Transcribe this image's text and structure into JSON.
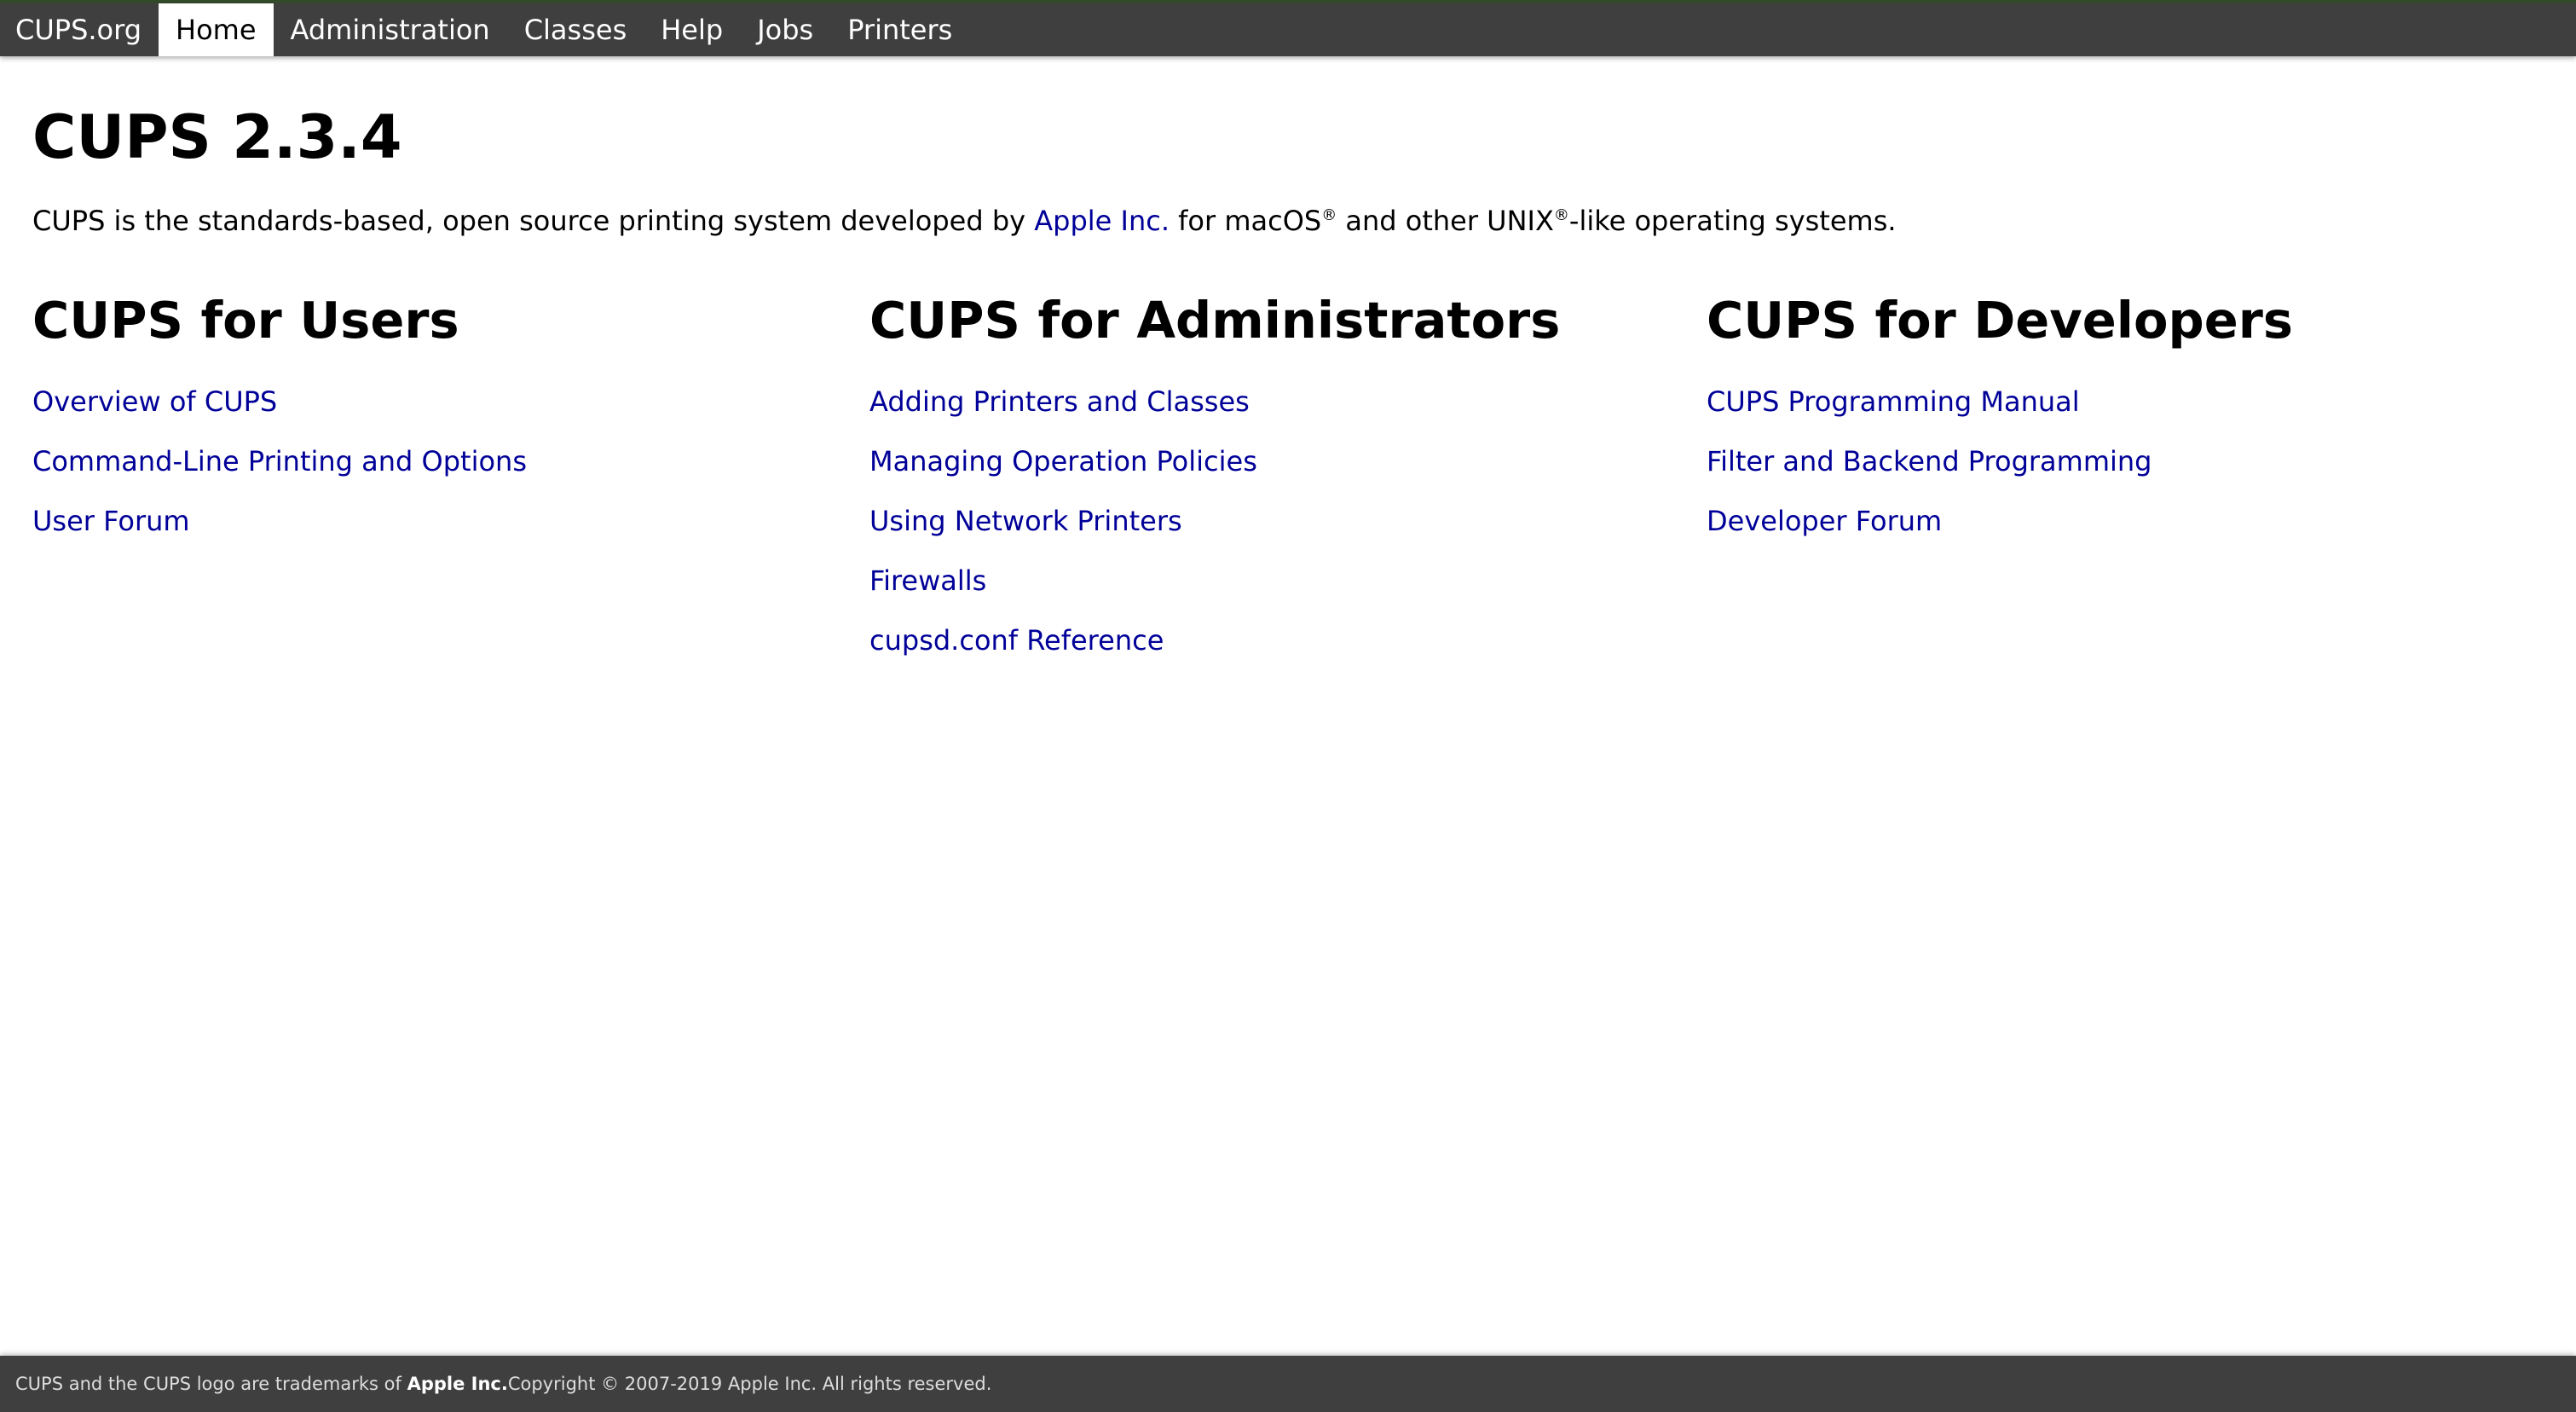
{
  "nav": {
    "brand": "CUPS.org",
    "items": [
      {
        "label": "Home",
        "active": true
      },
      {
        "label": "Administration",
        "active": false
      },
      {
        "label": "Classes",
        "active": false
      },
      {
        "label": "Help",
        "active": false
      },
      {
        "label": "Jobs",
        "active": false
      },
      {
        "label": "Printers",
        "active": false
      }
    ]
  },
  "main": {
    "title": "CUPS 2.3.4",
    "intro": {
      "before_link": "CUPS is the standards-based, open source printing system developed by ",
      "link": "Apple Inc.",
      "after_link": " for macOS",
      "registered_1": "®",
      "middle": " and other UNIX",
      "registered_2": "®",
      "end": "-like operating systems."
    },
    "columns": [
      {
        "title": "CUPS for Users",
        "links": [
          "Overview of CUPS",
          "Command-Line Printing and Options",
          "User Forum"
        ]
      },
      {
        "title": "CUPS for Administrators",
        "links": [
          "Adding Printers and Classes",
          "Managing Operation Policies",
          "Using Network Printers",
          "Firewalls",
          "cupsd.conf Reference"
        ]
      },
      {
        "title": "CUPS for Developers",
        "links": [
          "CUPS Programming Manual",
          "Filter and Backend Programming",
          "Developer Forum"
        ]
      }
    ]
  },
  "footer": {
    "before_link": "CUPS and the CUPS logo are trademarks of ",
    "link": "Apple Inc.",
    "after_link": " Copyright © 2007-2019 Apple Inc. All rights reserved."
  },
  "colors": {
    "header_bg": "#3f3f3f",
    "link": "#000099",
    "active_tab_bg": "#ffffff"
  }
}
